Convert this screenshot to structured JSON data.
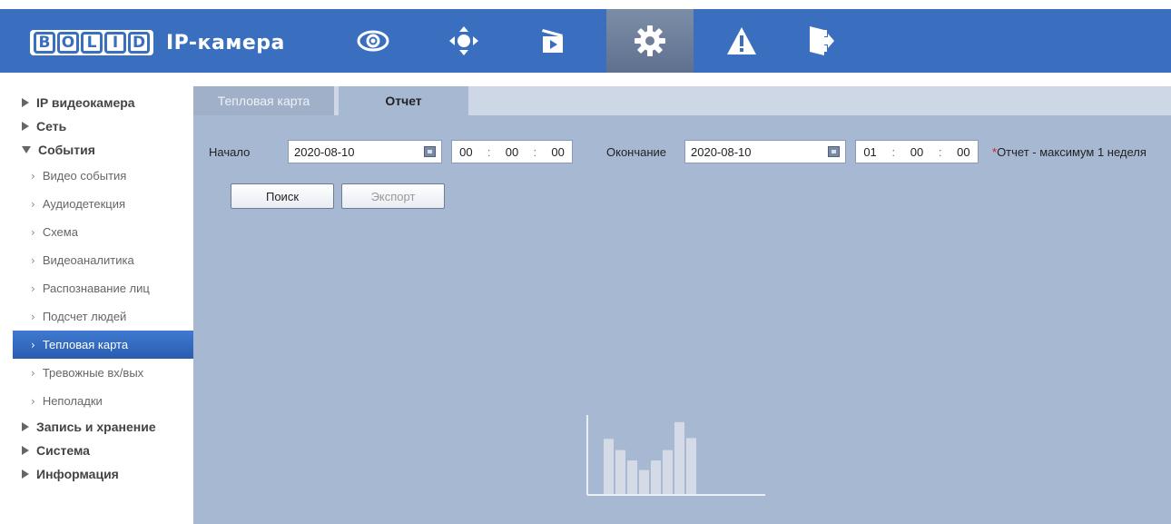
{
  "header": {
    "logo_letters": [
      "B",
      "O",
      "L",
      "I",
      "D"
    ],
    "app_title": "IP-камера",
    "nav_icons": [
      "eye-icon",
      "ptz-icon",
      "playback-icon",
      "settings-icon",
      "alarm-icon",
      "logout-icon"
    ],
    "active_nav": "settings-icon",
    "colors": {
      "bar": "#3a6fbf",
      "active": "#6f7f99"
    }
  },
  "sidebar": {
    "sections": [
      {
        "label": "IP видеокамера",
        "expanded": false
      },
      {
        "label": "Сеть",
        "expanded": false
      },
      {
        "label": "События",
        "expanded": true
      }
    ],
    "event_items": [
      "Видео события",
      "Аудиодетекция",
      "Схема",
      "Видеоаналитика",
      "Распознавание лиц",
      "Подсчет людей",
      "Тепловая карта",
      "Тревожные вх/вых",
      "Неполадки"
    ],
    "active_item": "Тепловая карта",
    "bottom_sections": [
      {
        "label": "Запись и хранение",
        "expanded": false
      },
      {
        "label": "Система",
        "expanded": false
      },
      {
        "label": "Информация",
        "expanded": false
      }
    ]
  },
  "tabs": {
    "inactive": "Тепловая карта",
    "active": "Отчет"
  },
  "form": {
    "start_label": "Начало",
    "start_date": "2020-08-10",
    "start_time": {
      "h": "00",
      "m": "00",
      "s": "00"
    },
    "end_label": "Окончание",
    "end_date": "2020-08-10",
    "end_time": {
      "h": "01",
      "m": "00",
      "s": "00"
    },
    "note_star": "*",
    "note": "Отчет - максимум 1 неделя",
    "search_button": "Поиск",
    "export_button": "Экспорт",
    "time_sep": ":"
  },
  "placeholder": {
    "bar_levels": [
      0.69,
      0.55,
      0.42,
      0.3,
      0.42,
      0.55,
      0.9,
      0.7
    ]
  }
}
